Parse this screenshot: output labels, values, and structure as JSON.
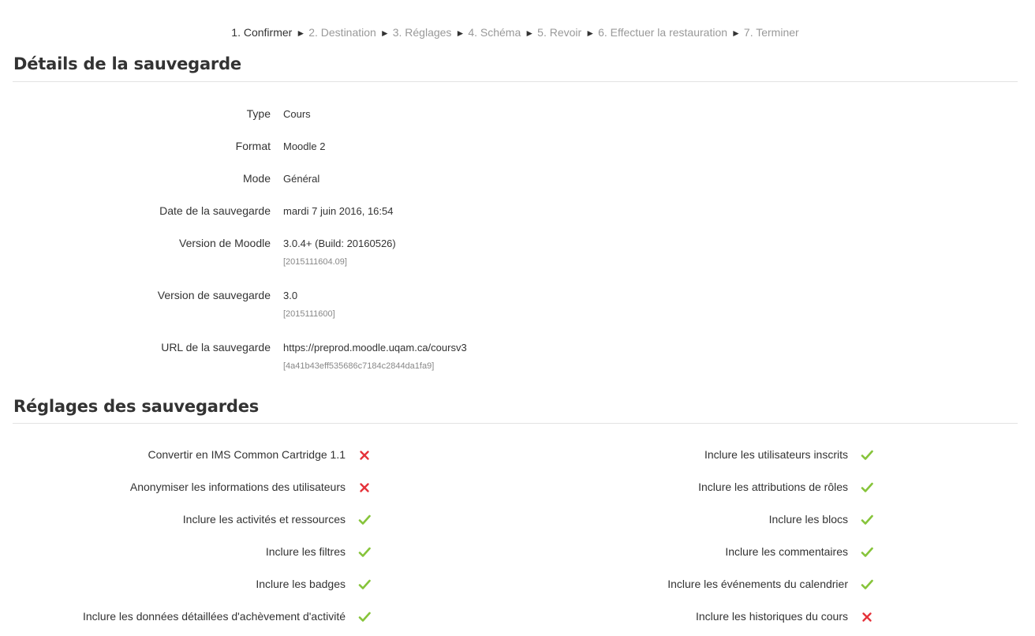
{
  "steps": [
    {
      "label": "1. Confirmer",
      "current": true
    },
    {
      "label": "2. Destination",
      "current": false
    },
    {
      "label": "3. Réglages",
      "current": false
    },
    {
      "label": "4. Schéma",
      "current": false
    },
    {
      "label": "5. Revoir",
      "current": false
    },
    {
      "label": "6. Effectuer la restauration",
      "current": false
    },
    {
      "label": "7. Terminer",
      "current": false
    }
  ],
  "step_separator": "►",
  "details": {
    "title": "Détails de la sauvegarde",
    "rows": [
      {
        "label": "Type",
        "value": "Cours",
        "sub": ""
      },
      {
        "label": "Format",
        "value": "Moodle 2",
        "sub": ""
      },
      {
        "label": "Mode",
        "value": "Général",
        "sub": ""
      },
      {
        "label": "Date de la sauvegarde",
        "value": "mardi 7 juin 2016, 16:54",
        "sub": ""
      },
      {
        "label": "Version de Moodle",
        "value": "3.0.4+ (Build: 20160526)",
        "sub": "[2015111604.09]"
      },
      {
        "label": "Version de sauvegarde",
        "value": "3.0",
        "sub": "[2015111600]"
      },
      {
        "label": "URL de la sauvegarde",
        "value": "https://preprod.moodle.uqam.ca/coursv3",
        "sub": "[4a41b43eff535686c7184c2844da1fa9]"
      }
    ]
  },
  "settings": {
    "title": "Réglages des sauvegardes",
    "left": [
      {
        "label": "Convertir en IMS Common Cartridge 1.1",
        "enabled": false
      },
      {
        "label": "Anonymiser les informations des utilisateurs",
        "enabled": false
      },
      {
        "label": "Inclure les activités et ressources",
        "enabled": true
      },
      {
        "label": "Inclure les filtres",
        "enabled": true
      },
      {
        "label": "Inclure les badges",
        "enabled": true
      },
      {
        "label": "Inclure les données détaillées d'achèvement d'activité",
        "enabled": true
      }
    ],
    "right": [
      {
        "label": "Inclure les utilisateurs inscrits",
        "enabled": true
      },
      {
        "label": "Inclure les attributions de rôles",
        "enabled": true
      },
      {
        "label": "Inclure les blocs",
        "enabled": true
      },
      {
        "label": "Inclure les commentaires",
        "enabled": true
      },
      {
        "label": "Inclure les événements du calendrier",
        "enabled": true
      },
      {
        "label": "Inclure les historiques du cours",
        "enabled": false
      }
    ]
  },
  "icons": {
    "enabled": "check-icon",
    "disabled": "cross-icon"
  },
  "colors": {
    "check": "#86c43a",
    "cross": "#e5323a",
    "muted": "#999999",
    "text": "#333333",
    "rule": "#e3e3e3"
  }
}
